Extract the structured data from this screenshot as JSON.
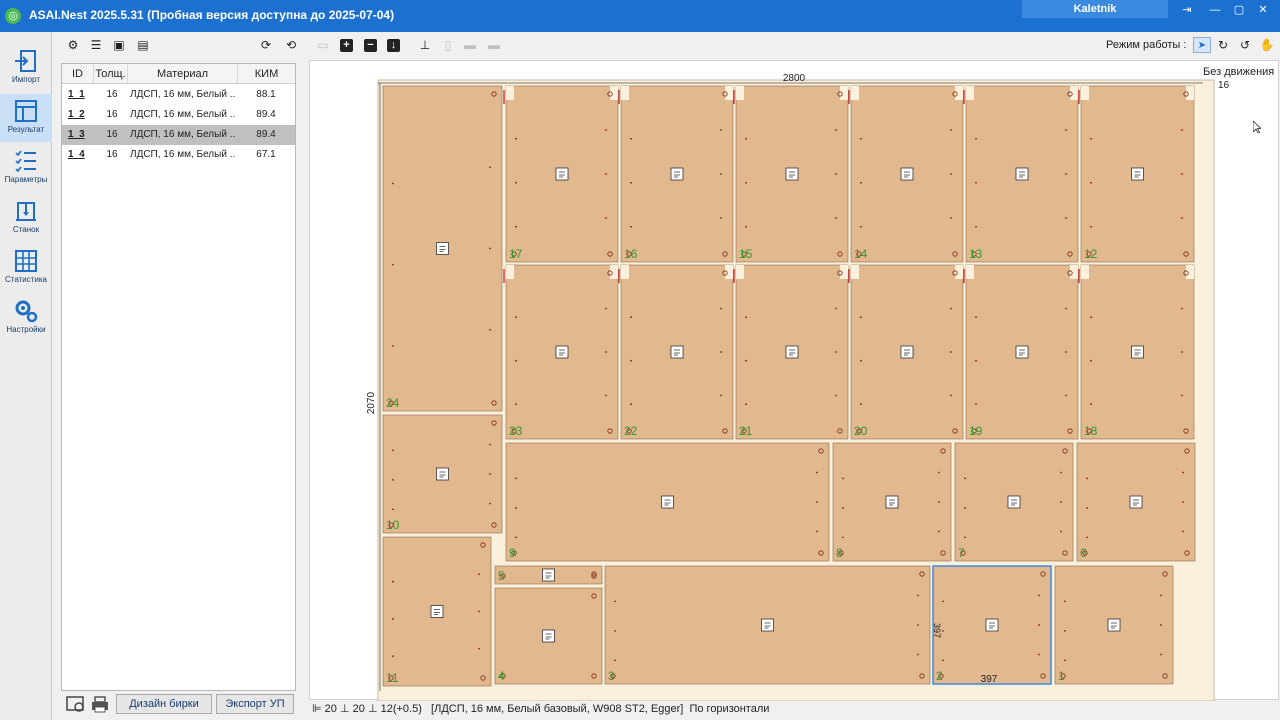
{
  "title": "ASAI.Nest   2025.5.31  (Пробная версия доступна до 2025-07-04)",
  "user": "Kaletnik",
  "nav": [
    {
      "label": "Импорт",
      "icon": "import-icon"
    },
    {
      "label": "Результат",
      "icon": "result-icon"
    },
    {
      "label": "Параметры",
      "icon": "parameters-icon"
    },
    {
      "label": "Станок",
      "icon": "machine-icon"
    },
    {
      "label": "Статистика",
      "icon": "statistics-icon"
    },
    {
      "label": "Настройки",
      "icon": "settings-icon"
    }
  ],
  "mode_label": "Режим работы :",
  "table": {
    "headers": [
      "ID",
      "Толщ.",
      "Материал",
      "КИМ"
    ],
    "rows": [
      {
        "id": "1_1",
        "thick": "16",
        "material": "ЛДСП, 16 мм, Белый ...",
        "kim": "88.1"
      },
      {
        "id": "1_2",
        "thick": "16",
        "material": "ЛДСП, 16 мм, Белый ...",
        "kim": "89.4"
      },
      {
        "id": "1_3",
        "thick": "16",
        "material": "ЛДСП, 16 мм, Белый ...",
        "kim": "89.4",
        "selected": true
      },
      {
        "id": "1_4",
        "thick": "16",
        "material": "ЛДСП, 16 мм, Белый ...",
        "kim": "67.1"
      }
    ]
  },
  "buttons": {
    "tag_design": "Дизайн бирки",
    "export": "Экспорт УП"
  },
  "sheet": {
    "width": "2800",
    "height": "2070",
    "motion": "Без движения",
    "motion_value": "16",
    "selected_width": "397",
    "selected_height": "397"
  },
  "parts": [
    {
      "n": "1"
    },
    {
      "n": "2"
    },
    {
      "n": "3"
    },
    {
      "n": "4"
    },
    {
      "n": "5"
    },
    {
      "n": "6"
    },
    {
      "n": "7"
    },
    {
      "n": "8"
    },
    {
      "n": "9"
    },
    {
      "n": "10"
    },
    {
      "n": "11"
    },
    {
      "n": "12"
    },
    {
      "n": "13"
    },
    {
      "n": "14"
    },
    {
      "n": "15"
    },
    {
      "n": "16"
    },
    {
      "n": "17"
    },
    {
      "n": "18"
    },
    {
      "n": "19"
    },
    {
      "n": "20"
    },
    {
      "n": "21"
    },
    {
      "n": "22"
    },
    {
      "n": "23"
    },
    {
      "n": "24"
    }
  ],
  "status": {
    "margin_a": "20",
    "margin_b": "20",
    "spacing": "12(+0.5)",
    "material": "[ЛДСП, 16 мм, Белый базовый, W908 ST2, Egger]",
    "orientation": "По горизонтали"
  },
  "colors": {
    "titlebar": "#1b70d0",
    "part": "#e2b88f",
    "part_label": "#2e9a2e",
    "selected_row": "#c0c0c0",
    "drill": "#7a2a10",
    "edge_mark": "#d01010"
  }
}
